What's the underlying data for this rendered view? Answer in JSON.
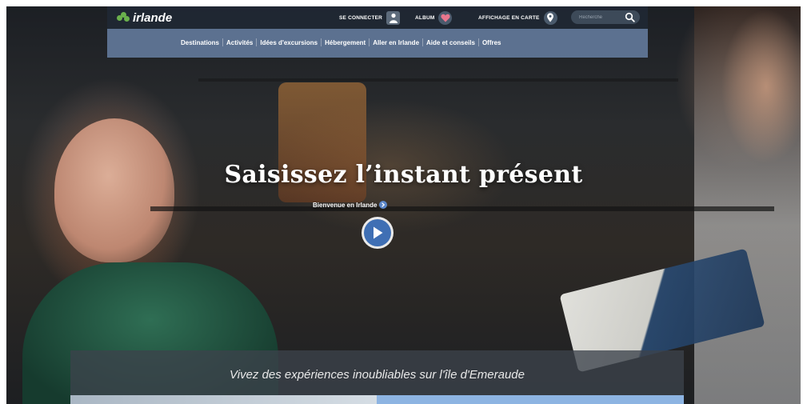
{
  "header": {
    "brand": "irlande",
    "signin_label": "SE CONNECTER",
    "album_label": "ALBUM",
    "map_label": "AFFICHAGE EN CARTE",
    "search_placeholder": "Recherche"
  },
  "nav": {
    "items": [
      "Destinations",
      "Activités",
      "Idées d'excursions",
      "Hébergement",
      "Aller en Irlande",
      "Aide et conseils",
      "Offres"
    ]
  },
  "hero": {
    "title": "Saisissez l’instant présent",
    "welcome_link": "Bienvenue en Irlande"
  },
  "tagline": "Vivez des expériences inoubliables sur l'île d'Emeraude",
  "colors": {
    "topbar": "#202834",
    "navbar": "#607696",
    "accent": "#3f6fb4",
    "logo_green": "#6ab04c"
  },
  "icons": {
    "signin": "user-icon",
    "album": "heart-icon",
    "map": "map-pin-icon",
    "search": "search-icon",
    "play": "play-icon"
  }
}
